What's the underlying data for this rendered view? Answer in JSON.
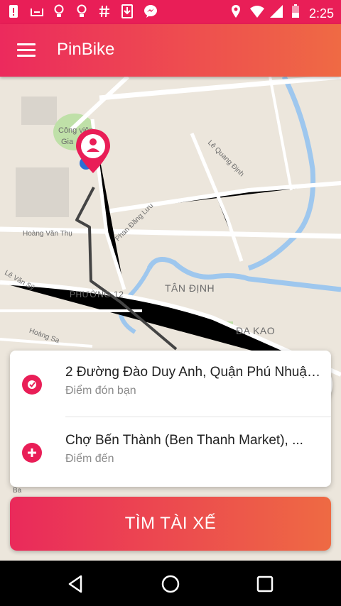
{
  "status_bar": {
    "left_icons": [
      "alert-icon",
      "tray-icon",
      "bulb-icon",
      "bulb-icon",
      "hash-icon",
      "download-icon",
      "messenger-icon"
    ],
    "right_icons": [
      "location-icon",
      "wifi-icon",
      "signal-icon",
      "battery-icon"
    ],
    "time": "2:25"
  },
  "app_bar": {
    "title": "PinBike"
  },
  "map": {
    "labels": {
      "cong_vien": "Công viên",
      "gia": "Gia",
      "le_quang_dinh": "Lê Quang Định",
      "phan_dang_luu": "Phan Đăng Lưu",
      "hoang_van_thu": "Hoàng Văn Thụ",
      "le_van_sy": "Lê Văn Sỹ",
      "phuong_12": "PHƯỜNG 12",
      "tan_dinh": "TÂN ĐỊNH",
      "da_kao": "ĐA KAO",
      "hoang_sa": "Hoàng Sa",
      "ba": "Ba"
    }
  },
  "trip_card": {
    "pickup": {
      "address": "2 Đường Đào Duy Anh, Quận Phú Nhuận...",
      "hint": "Điểm đón bạn"
    },
    "destination": {
      "address": "Chợ Bến Thành (Ben Thanh Market), ...",
      "hint": "Điểm đến"
    }
  },
  "find_driver_button": "TÌM TÀI XẾ",
  "colors": {
    "primary": "#e91e57",
    "gradient_end": "#ef6a44",
    "map_bg": "#ece6dc",
    "water": "#9ec7ee",
    "park": "#bfe0a8"
  }
}
